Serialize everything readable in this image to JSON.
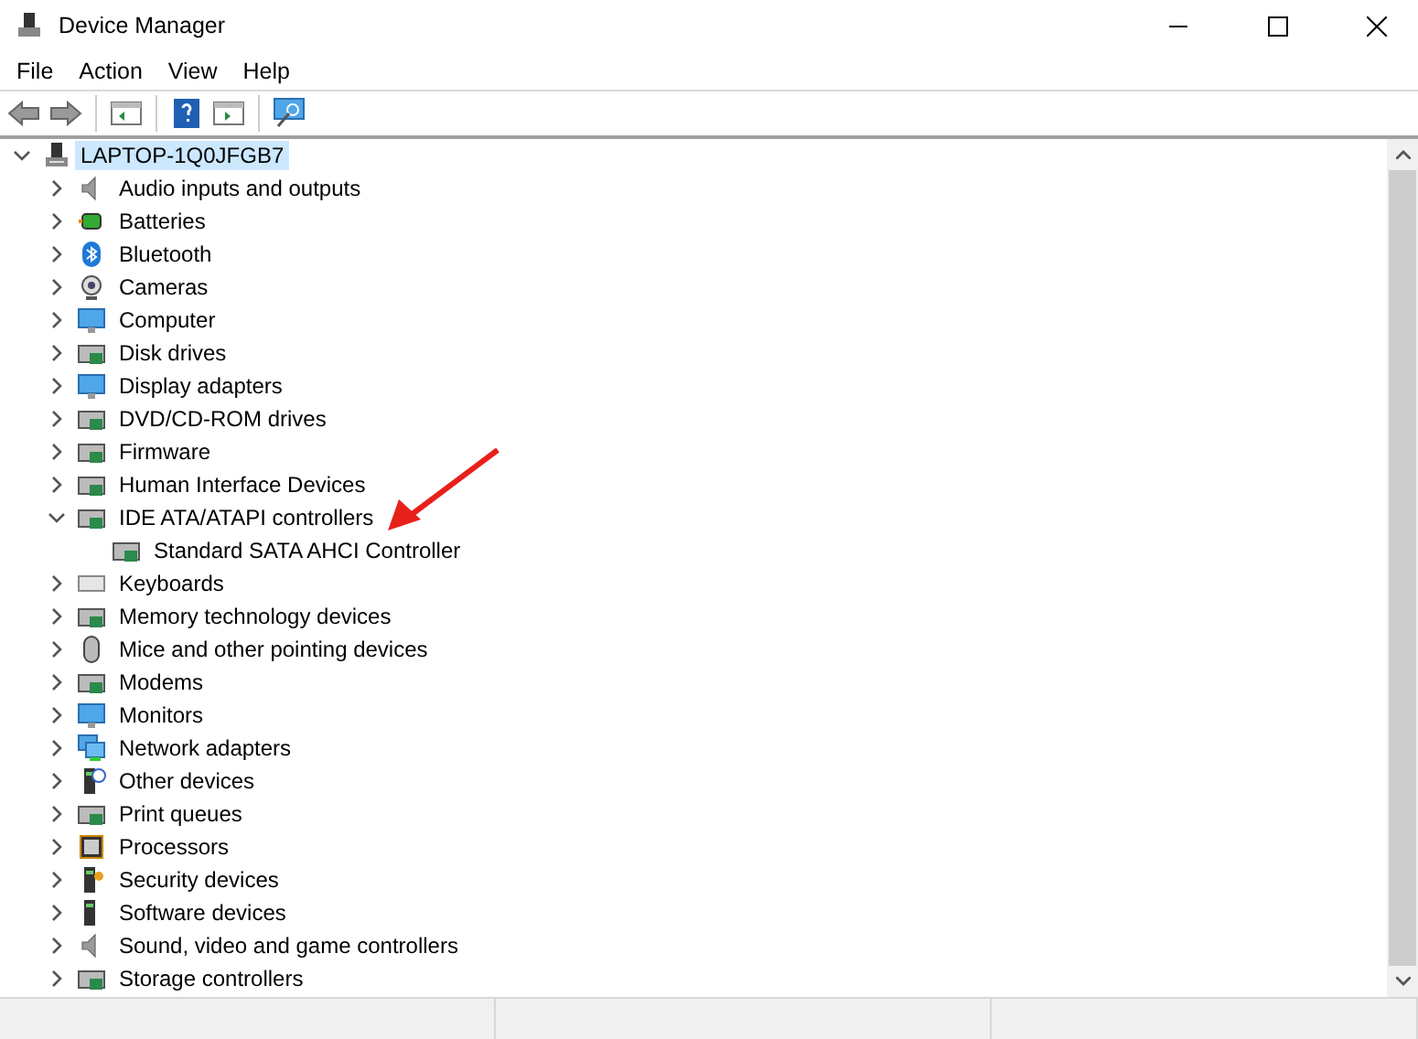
{
  "window": {
    "title": "Device Manager"
  },
  "menu": [
    "File",
    "Action",
    "View",
    "Help"
  ],
  "tree": [
    {
      "label": "LAPTOP-1Q0JFGB7",
      "expanded": true,
      "selected": true,
      "children": [
        {
          "label": "Audio inputs and outputs",
          "expanded": false,
          "selected": false
        },
        {
          "label": "Batteries",
          "expanded": false,
          "selected": false
        },
        {
          "label": "Bluetooth",
          "expanded": false,
          "selected": false
        },
        {
          "label": "Cameras",
          "expanded": false,
          "selected": false
        },
        {
          "label": "Computer",
          "expanded": false,
          "selected": false
        },
        {
          "label": "Disk drives",
          "expanded": false,
          "selected": false
        },
        {
          "label": "Display adapters",
          "expanded": false,
          "selected": false
        },
        {
          "label": "DVD/CD-ROM drives",
          "expanded": false,
          "selected": false
        },
        {
          "label": "Firmware",
          "expanded": false,
          "selected": false
        },
        {
          "label": "Human Interface Devices",
          "expanded": false,
          "selected": false
        },
        {
          "label": "IDE ATA/ATAPI controllers",
          "expanded": true,
          "selected": false,
          "children": [
            {
              "label": "Standard SATA AHCI Controller",
              "selected": false
            }
          ]
        },
        {
          "label": "Keyboards",
          "expanded": false,
          "selected": false
        },
        {
          "label": "Memory technology devices",
          "expanded": false,
          "selected": false
        },
        {
          "label": "Mice and other pointing devices",
          "expanded": false,
          "selected": false
        },
        {
          "label": "Modems",
          "expanded": false,
          "selected": false
        },
        {
          "label": "Monitors",
          "expanded": false,
          "selected": false
        },
        {
          "label": "Network adapters",
          "expanded": false,
          "selected": false
        },
        {
          "label": "Other devices",
          "expanded": false,
          "selected": false
        },
        {
          "label": "Print queues",
          "expanded": false,
          "selected": false
        },
        {
          "label": "Processors",
          "expanded": false,
          "selected": false
        },
        {
          "label": "Security devices",
          "expanded": false,
          "selected": false
        },
        {
          "label": "Software devices",
          "expanded": false,
          "selected": false
        },
        {
          "label": "Sound, video and game controllers",
          "expanded": false,
          "selected": false
        },
        {
          "label": "Storage controllers",
          "expanded": false,
          "selected": false
        }
      ]
    }
  ]
}
